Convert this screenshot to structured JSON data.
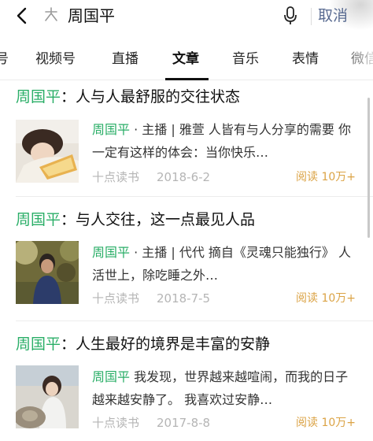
{
  "search": {
    "query": "周国平",
    "cancel_label": "取消"
  },
  "tabs": [
    {
      "label": "号"
    },
    {
      "label": "视频号"
    },
    {
      "label": "直播"
    },
    {
      "label": "文章"
    },
    {
      "label": "音乐"
    },
    {
      "label": "表情"
    },
    {
      "label": "微信"
    }
  ],
  "active_tab": "文章",
  "results": [
    {
      "title_keyword": "周国平",
      "title_rest": "：人与人最舒服的交往状态",
      "snippet_keyword": "周国平",
      "snippet_rest": " · 主播 | 雅萱 人皆有与人分享的需要 你一定有这样的体会：当你快乐…",
      "source": "十点读书",
      "date": "2018-6-2",
      "reads": "阅读 10万+"
    },
    {
      "title_keyword": "周国平",
      "title_rest": "：与人交往，这一点最见人品",
      "snippet_keyword": "周国平",
      "snippet_rest": " · 主播 | 代代 摘自《灵魂只能独行》 人活世上，除吃睡之外…",
      "source": "十点读书",
      "date": "2018-7-5",
      "reads": "阅读 10万+"
    },
    {
      "title_keyword": "周国平",
      "title_rest": "：人生最好的境界是丰富的安静",
      "snippet_keyword": "周国平",
      "snippet_rest": " 我发现，世界越来越喧闹，而我的日子越来越安静了。 我喜欢过安静…",
      "source": "十点读书",
      "date": "2017-8-8",
      "reads": "阅读 10万+"
    }
  ],
  "colors": {
    "highlight": "#2aae67",
    "cancel": "#596b91",
    "reads": "#dba345",
    "meta": "#b5b5b5"
  },
  "icons": [
    "back-arrow-icon",
    "search-sparkle-icon",
    "microphone-icon"
  ]
}
